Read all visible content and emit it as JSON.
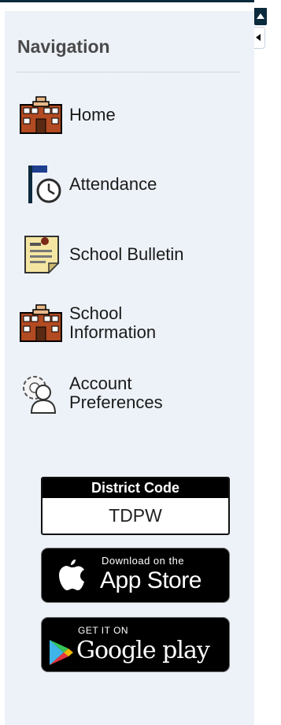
{
  "sidebar": {
    "title": "Navigation",
    "items": [
      {
        "label_lines": [
          "Home"
        ],
        "icon": "school-building-icon"
      },
      {
        "label_lines": [
          "Attendance"
        ],
        "icon": "attendance-clock-icon"
      },
      {
        "label_lines": [
          "School Bulletin"
        ],
        "icon": "bulletin-icon"
      },
      {
        "label_lines": [
          "School",
          "Information"
        ],
        "icon": "school-building-icon"
      },
      {
        "label_lines": [
          "Account",
          "Preferences"
        ],
        "icon": "account-gear-icon"
      }
    ]
  },
  "district": {
    "title": "District Code",
    "code": "TDPW"
  },
  "app_store": {
    "small": "Download on the",
    "big": "App Store"
  },
  "google_play": {
    "small": "GET IT ON",
    "big": "Google play"
  },
  "colors": {
    "panel_bg": "#edf2f8",
    "top_bar": "#0b2a3c",
    "building_brick": "#9b3b1b"
  }
}
